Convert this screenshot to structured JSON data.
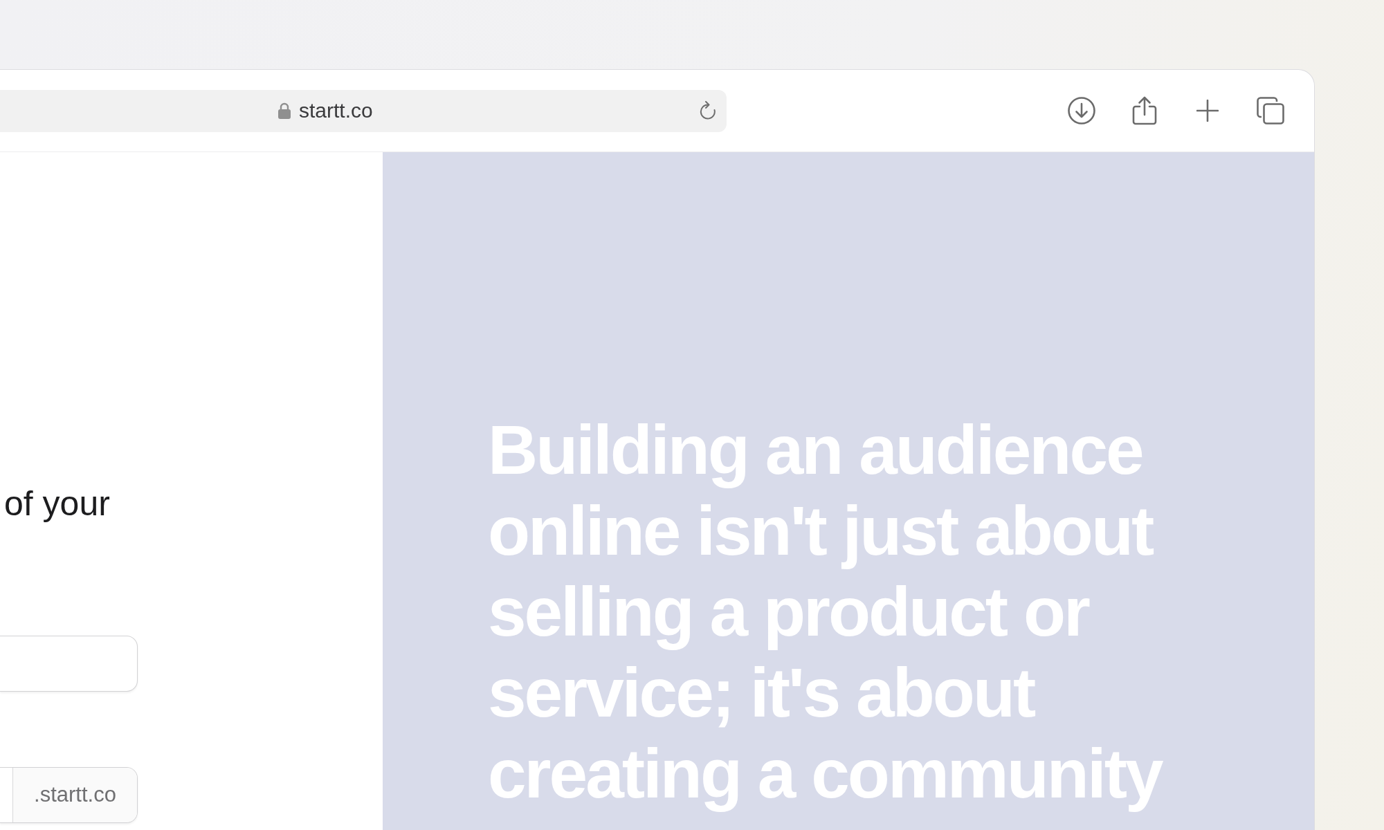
{
  "browser_toolbar": {
    "url": "startt.co"
  },
  "signup_form": {
    "heading": "of your",
    "subdomain_field": {
      "suffix": ".startt.co"
    }
  },
  "quote_panel": {
    "text": "Building an audience online isn't just about selling a product or service; it's about creating a community"
  }
}
